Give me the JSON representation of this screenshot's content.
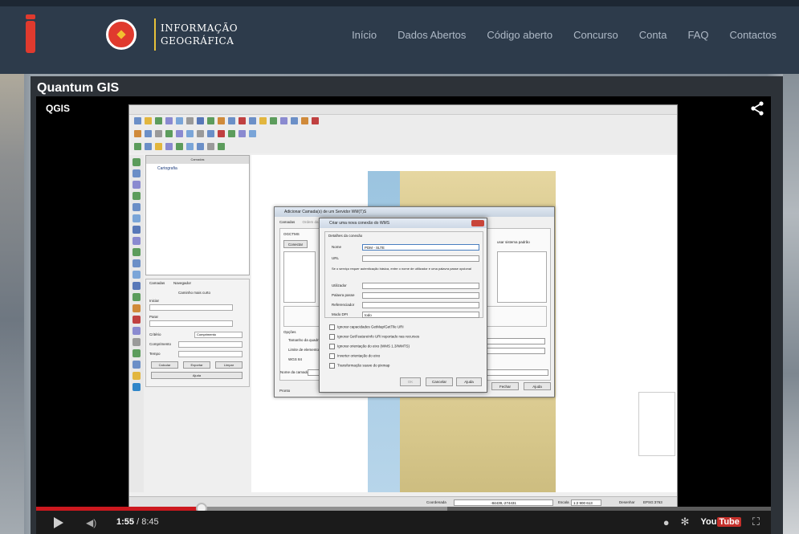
{
  "site": {
    "logo_text": "iGEO",
    "logo_sub_line1": "INFORMAÇÃO",
    "logo_sub_line2": "GEOGRÁFICA"
  },
  "nav": [
    {
      "label": "Início"
    },
    {
      "label": "Dados Abertos"
    },
    {
      "label": "Código aberto"
    },
    {
      "label": "Concurso"
    },
    {
      "label": "Conta"
    },
    {
      "label": "FAQ"
    },
    {
      "label": "Contactos"
    }
  ],
  "panel": {
    "title": "Quantum GIS"
  },
  "video": {
    "title": "QGIS",
    "current_time": "1:55",
    "separator": " / ",
    "duration": "8:45",
    "progress_fraction": 0.225,
    "buffer_fraction": 0.56,
    "youtube_label": "You",
    "youtube_tube": "Tube"
  },
  "qgis": {
    "layers_header": "Camadas",
    "layer_item": "Cartografia",
    "lower_panel": {
      "tab1": "Camadas",
      "tab2": "Navegador",
      "title": "Caminho mais curto",
      "label_start": "Iniciar",
      "label_stop": "Parar",
      "label_criteria": "Critério",
      "criteria_value": "Comprimento",
      "label_length": "Comprimento",
      "label_time": "Tempo",
      "btn_calc": "Calcular",
      "btn_export": "Exportar",
      "btn_clear": "Limpar",
      "btn_help": "Ajuda"
    },
    "status": {
      "coord_label": "Coordenada",
      "coord_value": "-84439,-274431",
      "scale_label": "Escala",
      "scale_value": "1:2 900 613",
      "render_label": "Desenhar",
      "epsg": "EPSG:3763"
    },
    "dialog1": {
      "title": "Adicionar Camada(s) de um Servidor WM(T)S",
      "tab1": "Camadas",
      "tab2": "Ordem da",
      "connect_btn": "Conectar",
      "ogctms": "OGCTMS",
      "coord_label": "Sistema de referência",
      "coord_value": "WGS 84",
      "tile_label": "Tamanho da quadrícula",
      "limit_label": "Limite de elementos",
      "layer_name_label": "Nome da camada",
      "status_text": "Pronto",
      "default_btn": "usar sistema padrão",
      "close_btn": "Fechar",
      "help_btn": "Ajuda",
      "options_label": "Opções"
    },
    "dialog2": {
      "title": "Criar uma nova conexão do WMS",
      "group_title": "Detalhes da conexão",
      "name_label": "Nome",
      "name_value": "PDM - SLTE",
      "url_label": "URL",
      "url_value": "",
      "auth_note": "Se o serviço requer autenticação básica, entre o nome de utilizador e uma palavra passe opcional",
      "user_label": "Utilizador",
      "pass_label": "Palavra passe",
      "referer_label": "Referenciador",
      "dpi_label": "Modo DPI",
      "dpi_value": "todo",
      "cb1": "Ignorar capacidades GetMap/GetTile URI",
      "cb2": "Ignorar GetFeatureInfo URI reportado nas recursos",
      "cb3": "Ignorar orientação do eixo (WMS 1.3/WMTS)",
      "cb4": "Inverter orientação do eixo",
      "cb5": "Transformação suave do pixmap",
      "ok_btn": "OK",
      "cancel_btn": "Cancelar",
      "help_btn": "Ajuda"
    }
  },
  "colors": {
    "header_bg": "#2d3b4b",
    "logo_red": "#e03a2e",
    "nav_text": "#aeb9c6",
    "progress_red": "#cc181e"
  }
}
